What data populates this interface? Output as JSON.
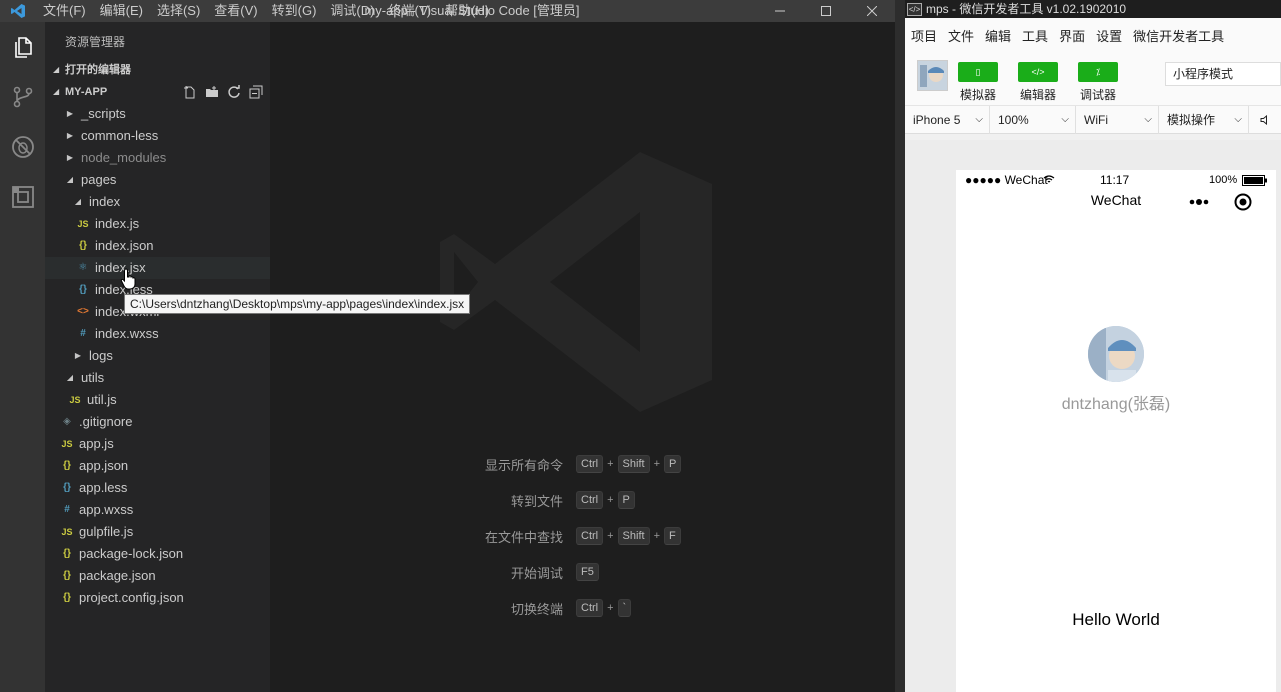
{
  "vscode": {
    "menu": [
      "文件(F)",
      "编辑(E)",
      "选择(S)",
      "查看(V)",
      "转到(G)",
      "调试(D)",
      "终端(T)",
      "帮助(H)"
    ],
    "title": "my-app - Visual Studio Code [管理员]",
    "explorer_title": "资源管理器",
    "open_editors": "打开的编辑器",
    "project": "MY-APP",
    "tree": {
      "scripts": "_scripts",
      "common_less": "common-less",
      "node_modules": "node_modules",
      "pages": "pages",
      "index": "index",
      "index_js": "index.js",
      "index_json": "index.json",
      "index_jsx": "index.jsx",
      "index_less": "index.less",
      "index_wxml": "index.wxml",
      "index_wxss": "index.wxss",
      "logs": "logs",
      "utils": "utils",
      "util_js": "util.js",
      "gitignore": ".gitignore",
      "app_js": "app.js",
      "app_json": "app.json",
      "app_less": "app.less",
      "app_wxss": "app.wxss",
      "gulpfile": "gulpfile.js",
      "package_lock": "package-lock.json",
      "package_json": "package.json",
      "project_config": "project.config.json"
    },
    "tooltip": "C:\\Users\\dntzhang\\Desktop\\mps\\my-app\\pages\\index\\index.jsx",
    "shortcuts": [
      {
        "label": "显示所有命令",
        "keys": [
          "Ctrl",
          "Shift",
          "P"
        ]
      },
      {
        "label": "转到文件",
        "keys": [
          "Ctrl",
          "P"
        ]
      },
      {
        "label": "在文件中查找",
        "keys": [
          "Ctrl",
          "Shift",
          "F"
        ]
      },
      {
        "label": "开始调试",
        "keys": [
          "F5"
        ]
      },
      {
        "label": "切换终端",
        "keys": [
          "Ctrl",
          "`"
        ]
      }
    ]
  },
  "wechat": {
    "title": "mps - 微信开发者工具 v1.02.1902010",
    "menu": [
      "项目",
      "文件",
      "编辑",
      "工具",
      "界面",
      "设置",
      "微信开发者工具"
    ],
    "tools": {
      "simulator": "模拟器",
      "editor": "编辑器",
      "debugger": "调试器"
    },
    "mode": "小程序模式",
    "device": "iPhone 5",
    "zoom": "100%",
    "network": "WiFi",
    "sim_op": "模拟操作",
    "phone": {
      "carrier": "●●●●● WeChat",
      "time": "11:17",
      "battery": "100%",
      "nav_title": "WeChat",
      "username": "dntzhang(张磊)",
      "hello": "Hello World"
    }
  }
}
